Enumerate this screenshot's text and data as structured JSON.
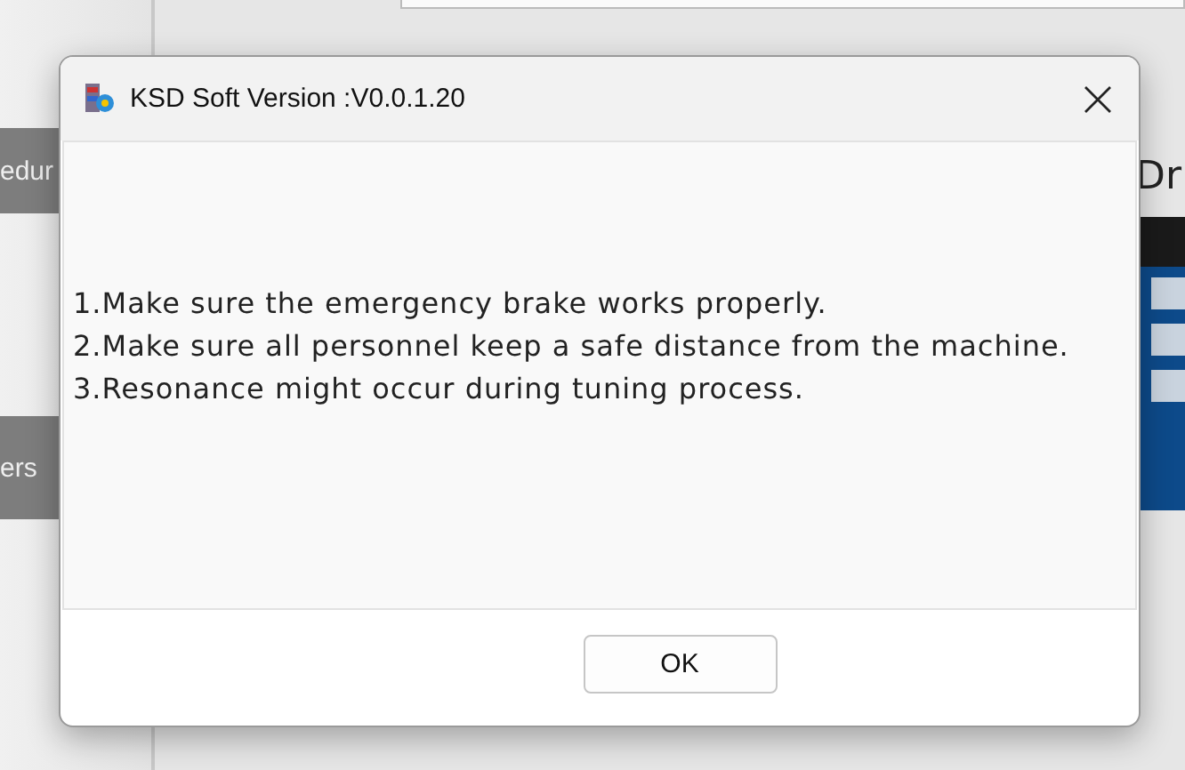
{
  "background": {
    "sidebar_buttons": [
      "edur",
      "ers"
    ],
    "heading": "Dr"
  },
  "dialog": {
    "title": "KSD Soft Version :V0.0.1.20",
    "message_lines": [
      "1.Make sure the emergency brake works properly.",
      "2.Make sure all personnel keep a safe distance from the machine.",
      "3.Resonance might occur during tuning process."
    ],
    "buttons": [
      "OK"
    ]
  }
}
